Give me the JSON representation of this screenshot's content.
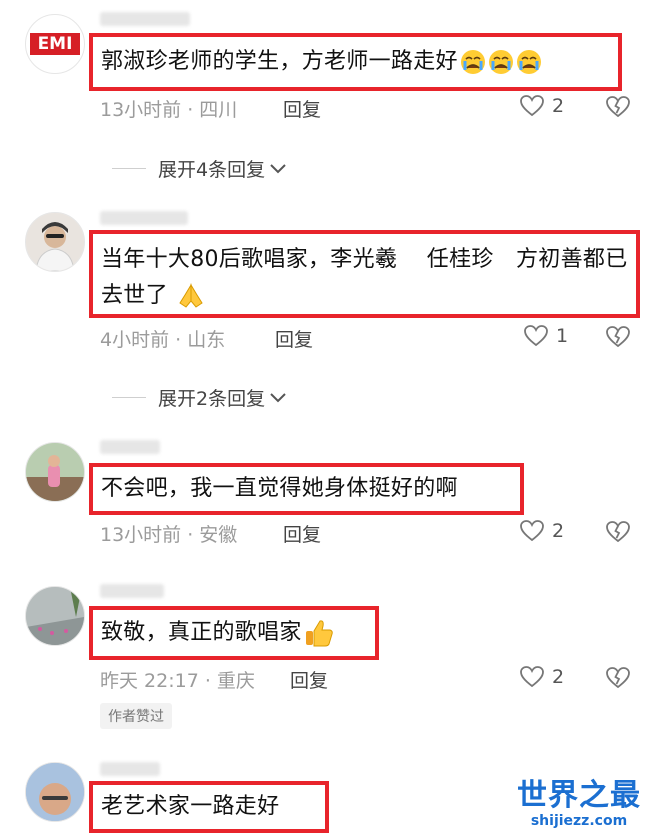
{
  "comments": [
    {
      "text": "郭淑珍老师的学生，方老师一路走好",
      "time_location": "13小时前 · 四川",
      "reply_label": "回复",
      "likes": "2",
      "avatar_text": "EMI",
      "emoji": "crying-face"
    },
    {
      "text": "当年十大80后歌唱家，李光羲　 任桂珍　方初善都已去世了",
      "time_location": "4小时前 · 山东",
      "reply_label": "回复",
      "likes": "1",
      "emoji": "folded-hands"
    },
    {
      "text": "不会吧，我一直觉得她身体挺好的啊",
      "time_location": "13小时前 · 安徽",
      "reply_label": "回复",
      "likes": "2"
    },
    {
      "text": "致敬，真正的歌唱家",
      "time_location": "昨天 22:17 · 重庆",
      "reply_label": "回复",
      "likes": "2",
      "badge": "作者赞过",
      "emoji": "thumbs-up"
    },
    {
      "text": "老艺术家一路走好"
    }
  ],
  "expand_replies": [
    {
      "label": "展开4条回复"
    },
    {
      "label": "展开2条回复"
    }
  ],
  "watermark": {
    "title": "世界之最",
    "url": "shijiezz.com"
  },
  "colors": {
    "highlight_border": "#e8242b",
    "meta_text": "#9b9b9b",
    "watermark": "#1b6fd1"
  }
}
